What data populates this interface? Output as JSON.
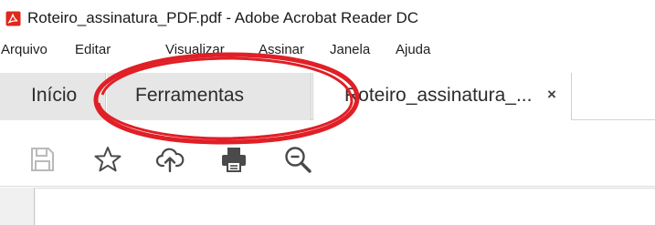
{
  "window": {
    "title": "Roteiro_assinatura_PDF.pdf - Adobe Acrobat Reader DC",
    "app_icon": "acrobat-reader-icon",
    "app_icon_color": "#e0271a"
  },
  "menubar": {
    "items": [
      {
        "label": "Arquivo"
      },
      {
        "label": "Editar"
      },
      {
        "label": "Visualizar"
      },
      {
        "label": "Assinar"
      },
      {
        "label": "Janela"
      },
      {
        "label": "Ajuda"
      }
    ]
  },
  "tabs": {
    "home_label": "Início",
    "tools_label": "Ferramentas",
    "document_label": "Roteiro_assinatura_...",
    "close_glyph": "×"
  },
  "toolbar": {
    "icons": [
      "save-icon",
      "bookmark-star-icon",
      "upload-cloud-icon",
      "print-icon",
      "zoom-out-icon"
    ]
  },
  "annotation": {
    "color": "#e01f26",
    "shape": "ellipse"
  }
}
